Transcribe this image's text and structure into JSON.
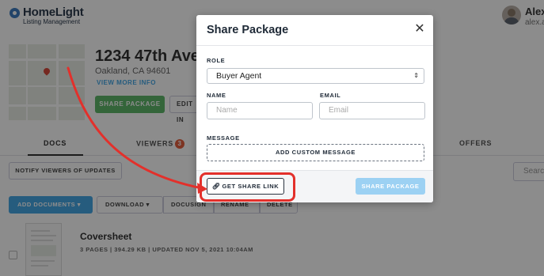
{
  "brand": {
    "name": "HomeLight",
    "sub": "Listing Management"
  },
  "user": {
    "name": "Alex",
    "email": "alex.a"
  },
  "property": {
    "title": "1234 47th Ave",
    "city": "Oakland, CA 94601",
    "view_more": "VIEW MORE INFO",
    "share_label": "SHARE PACKAGE",
    "edit_label": "EDIT IN"
  },
  "tabs": {
    "docs": "DOCS",
    "viewers": "VIEWERS",
    "viewers_count": "3",
    "offers": "OFFERS"
  },
  "toolbar": {
    "notify": "NOTIFY VIEWERS OF UPDATES",
    "search": "Search",
    "add_documents": "ADD DOCUMENTS",
    "download": "DOWNLOAD",
    "docusign": "DOCUSIGN",
    "rename": "RENAME",
    "delete": "DELETE"
  },
  "document": {
    "title": "Coversheet",
    "meta": "3 PAGES | 394.29 KB | UPDATED NOV 5, 2021 10:04AM"
  },
  "modal": {
    "title": "Share Package",
    "role_label": "ROLE",
    "role_value": "Buyer Agent",
    "name_label": "NAME",
    "name_placeholder": "Name",
    "email_label": "EMAIL",
    "email_placeholder": "Email",
    "message_label": "MESSAGE",
    "custom_message": "ADD CUSTOM MESSAGE",
    "get_link": "GET SHARE LINK",
    "share": "SHARE PACKAGE"
  },
  "colors": {
    "annotation": "#e3302b",
    "primary": "#46a8e6",
    "share_disabled": "#9cd1f3"
  }
}
